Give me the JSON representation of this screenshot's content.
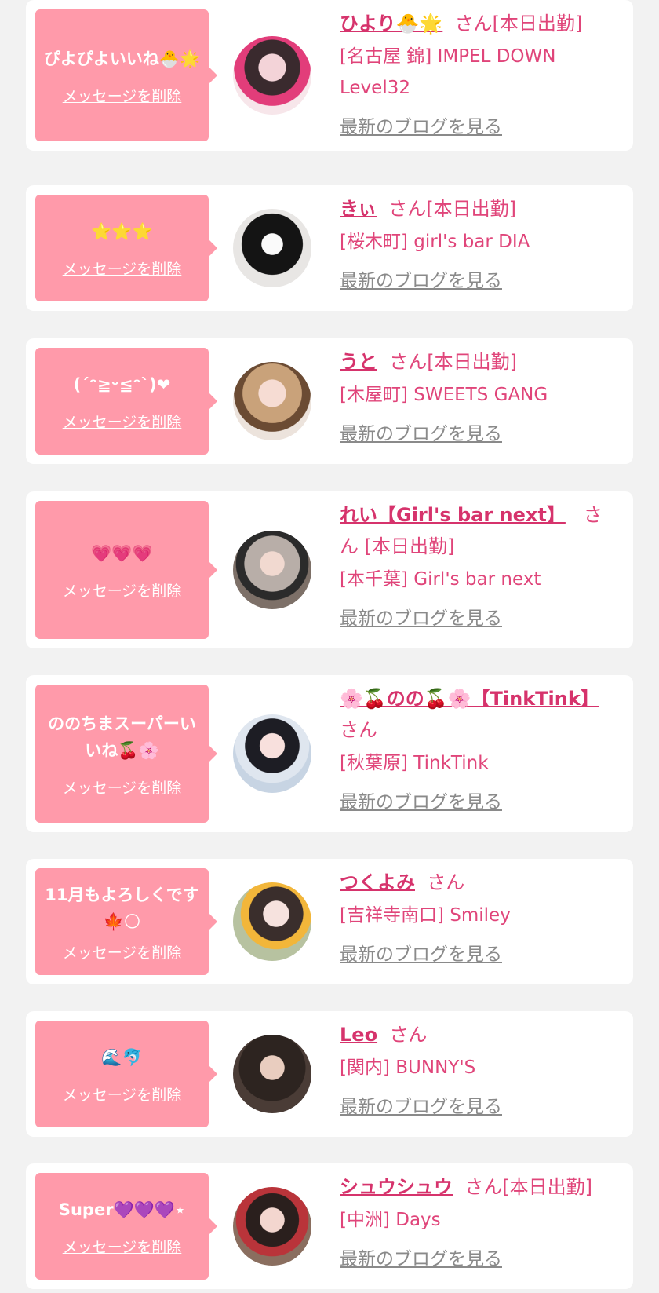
{
  "delete_label": "メッセージを削除",
  "blog_label": "最新のブログを見る",
  "san_label": "さん",
  "today_badge": "[本日出勤]",
  "colors": {
    "background": "#f2f2f2",
    "bubble": "#ff9aaa",
    "name": "#d6336c",
    "shop": "#e0457a",
    "blog": "#8a8a8a"
  },
  "items": [
    {
      "message": "ぴよぴよいいね🐣🌟",
      "name": "ひより🐣🌟",
      "today": "[本日出勤]",
      "shop": "[名古屋 錦] IMPEL DOWN Level32"
    },
    {
      "message": "⭐️⭐️⭐️",
      "name": "きぃ",
      "today": "[本日出勤]",
      "shop": "[桜木町] girl's bar DIA"
    },
    {
      "message": "(´ᵔ≧ᵕ≦ᵔ`)❤",
      "name": "うと",
      "today": "[本日出勤]",
      "shop": "[木屋町] SWEETS GANG"
    },
    {
      "message": "💗💗💗",
      "name": "れい【Girl's bar next】",
      "today": "[本日出勤]",
      "shop": "[本千葉] Girl's bar next"
    },
    {
      "message": "ののちまスーパーいいね🍒🌸",
      "name": "🌸🍒のの🍒🌸【TinkTink】",
      "today": "",
      "shop": "[秋葉原] TinkTink"
    },
    {
      "message": "11月もよろしくです🍁🌕",
      "name": "つくよみ",
      "today": "",
      "shop": "[吉祥寺南口] Smiley"
    },
    {
      "message": "🌊🐬",
      "name": "Leo",
      "today": "",
      "shop": "[関内] BUNNY'S"
    },
    {
      "message": "Super💜💜💜⋆",
      "name": "シュウシュウ",
      "today": "[本日出勤]",
      "shop": "[中洲] Days"
    }
  ]
}
